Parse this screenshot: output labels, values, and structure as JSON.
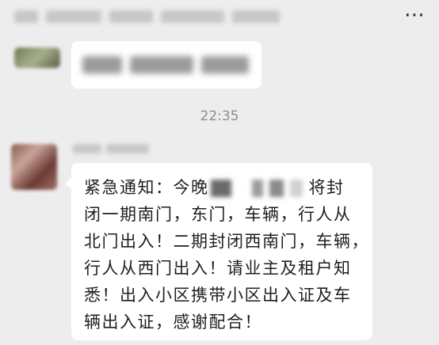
{
  "chat": {
    "timestamp": "22:35",
    "message": {
      "line1_start": "紧急通知：今晚",
      "line1_end": "将封",
      "line2": "闭一期南门，东门，车辆，行人从",
      "line3": "北门出入！二期封闭西南门，车辆，",
      "line4": "行人从西门出入！请业主及租户知",
      "line5": "悉！出入小区携带小区出入证及车",
      "line6": "辆出入证，感谢配合！"
    }
  },
  "icons": {
    "more": "more-icon"
  },
  "colors": {
    "background": "#ededed",
    "bubble": "#ffffff",
    "timestamp": "#8d8d8d"
  }
}
